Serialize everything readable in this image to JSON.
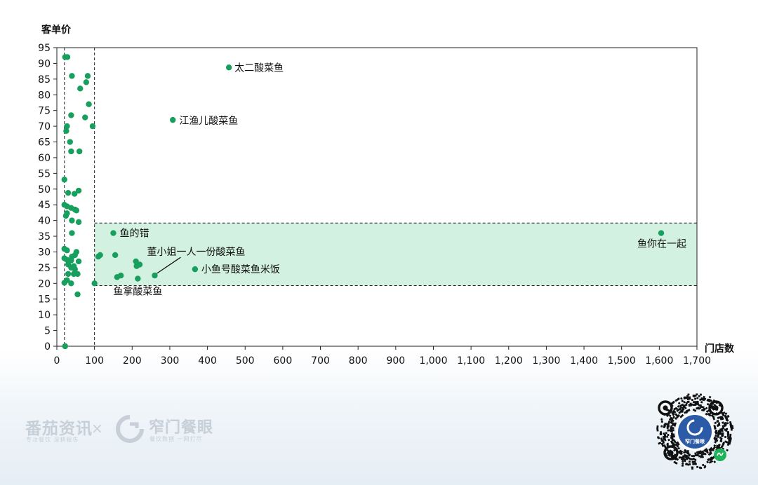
{
  "chart_data": {
    "type": "scatter",
    "ylabel": "客单价",
    "xlabel": "门店数",
    "xlim": [
      0,
      1700
    ],
    "ylim": [
      0,
      95
    ],
    "xticks": [
      0,
      100,
      200,
      300,
      400,
      500,
      600,
      700,
      800,
      900,
      1000,
      1100,
      1200,
      1300,
      1400,
      1500,
      1600,
      1700
    ],
    "xtick_labels": [
      "0",
      "100",
      "200",
      "300",
      "400",
      "500",
      "600",
      "700",
      "800",
      "900",
      "1,000",
      "1,100",
      "1,200",
      "1,300",
      "1,400",
      "1,500",
      "1,600",
      "1,700"
    ],
    "yticks": [
      0,
      5,
      10,
      15,
      20,
      25,
      30,
      35,
      40,
      45,
      50,
      55,
      60,
      65,
      70,
      75,
      80,
      85,
      90,
      95
    ],
    "ref_lines": {
      "vertical": [
        20,
        100
      ],
      "horizontal": [
        19.3,
        39.2
      ]
    },
    "highlight_band": {
      "x": [
        100,
        1700
      ],
      "y": [
        19.3,
        39.2
      ],
      "color": "#d3f1e0"
    },
    "point_color": "#17a05d",
    "points": [
      [
        22,
        92
      ],
      [
        28,
        92
      ],
      [
        40,
        86
      ],
      [
        82,
        86
      ],
      [
        78,
        84
      ],
      [
        62,
        82
      ],
      [
        85,
        77
      ],
      [
        38,
        73.5
      ],
      [
        75,
        72.8
      ],
      [
        95,
        70
      ],
      [
        27,
        70
      ],
      [
        25,
        68.5
      ],
      [
        35,
        65
      ],
      [
        38,
        62
      ],
      [
        60,
        62
      ],
      [
        20,
        53
      ],
      [
        58,
        49.5
      ],
      [
        30,
        48.8
      ],
      [
        47,
        48.5
      ],
      [
        20,
        45
      ],
      [
        27,
        44.5
      ],
      [
        38,
        44
      ],
      [
        48,
        43.5
      ],
      [
        52,
        43.2
      ],
      [
        27,
        42.3
      ],
      [
        24,
        41.5
      ],
      [
        40,
        40
      ],
      [
        58,
        39.5
      ],
      [
        40,
        36
      ],
      [
        20,
        31
      ],
      [
        27,
        30.5
      ],
      [
        52,
        30
      ],
      [
        48,
        29
      ],
      [
        40,
        28.5
      ],
      [
        20,
        28
      ],
      [
        27,
        27.5
      ],
      [
        38,
        27.3
      ],
      [
        58,
        27
      ],
      [
        30,
        26
      ],
      [
        45,
        25.5
      ],
      [
        38,
        25
      ],
      [
        48,
        24.5
      ],
      [
        30,
        23
      ],
      [
        45,
        23
      ],
      [
        55,
        23
      ],
      [
        27,
        21
      ],
      [
        20,
        20.2
      ],
      [
        38,
        20
      ],
      [
        55,
        16.5
      ],
      [
        22,
        0
      ],
      [
        100,
        20
      ],
      [
        110,
        28.5
      ],
      [
        115,
        29
      ],
      [
        150,
        36
      ],
      [
        155,
        29
      ],
      [
        160,
        22
      ],
      [
        170,
        22.5
      ],
      [
        210,
        27
      ],
      [
        212,
        25.5
      ],
      [
        220,
        26
      ],
      [
        215,
        21.5
      ],
      [
        260,
        22.5
      ],
      [
        308,
        72
      ],
      [
        367,
        24.5
      ],
      [
        457,
        88.7
      ],
      [
        1605,
        36
      ]
    ],
    "annotations": [
      {
        "text": "太二酸菜鱼",
        "x": 457,
        "y": 88.7,
        "anchor": "start"
      },
      {
        "text": "江渔儿酸菜鱼",
        "x": 308,
        "y": 72,
        "anchor": "start"
      },
      {
        "text": "鱼的错",
        "x": 150,
        "y": 36,
        "anchor": "start"
      },
      {
        "text": "鱼你在一起",
        "x": 1605,
        "y": 36,
        "anchor": "end"
      },
      {
        "text": "董小姐一人一份酸菜鱼",
        "x": 260,
        "y": 22.5,
        "anchor": "start"
      },
      {
        "text": "小鱼号酸菜鱼米饭",
        "x": 367,
        "y": 24.5,
        "anchor": "start"
      },
      {
        "text": "鱼拿酸菜鱼",
        "x": 215,
        "y": 21.5,
        "anchor": "middle"
      }
    ]
  },
  "footer": {
    "brand1_name": "番茄资讯",
    "brand1_slogan": "专注餐饮 深耕报告",
    "times_sign": "×",
    "brand2_name": "窄门餐眼",
    "brand2_slogan": "餐饮数据 一网打尽",
    "qr_label": "窄门餐眼"
  }
}
